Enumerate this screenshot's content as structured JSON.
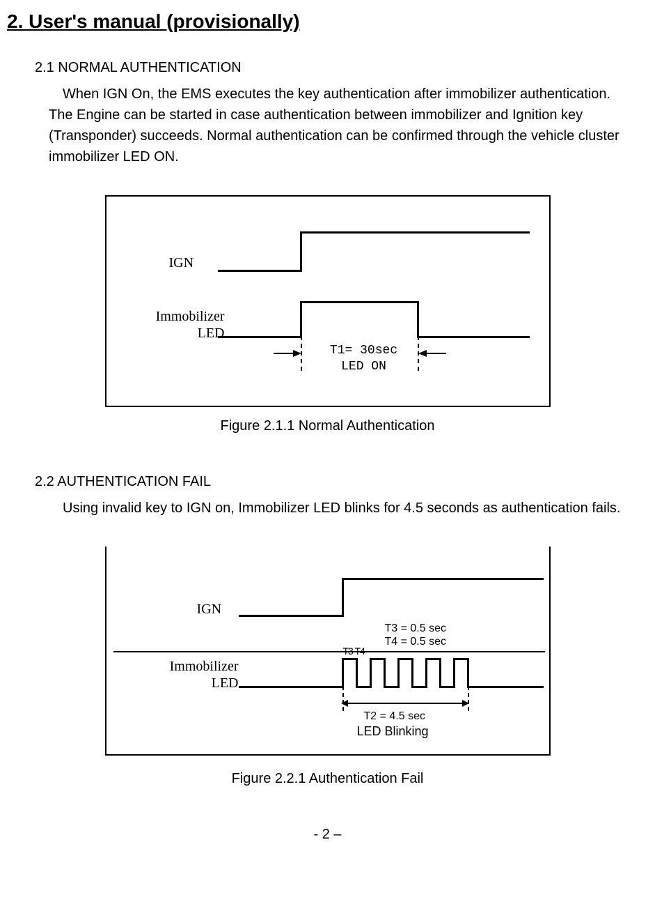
{
  "heading": "2. User's manual (provisionally)",
  "section21": {
    "title": "2.1 NORMAL AUTHENTICATION",
    "para": "When IGN On, the EMS executes the key authentication after immobilizer authentication. The Engine can be started in case authentication between immobilizer and Ignition key (Transponder) succeeds. Normal authentication can be confirmed through the vehicle cluster immobilizer LED ON."
  },
  "fig1": {
    "ign": "IGN",
    "immobilizer": "Immobilizer",
    "led": "LED",
    "t1_line1": "T1= 30sec",
    "t1_line2": "LED ON",
    "caption": "Figure 2.1.1 Normal Authentication"
  },
  "section22": {
    "title": "2.2 AUTHENTICATION FAIL",
    "para": "Using invalid key to IGN on, Immobilizer LED blinks for 4.5 seconds as authentication fails."
  },
  "fig2": {
    "ign": "IGN",
    "immobilizer": "Immobilizer",
    "led": "LED",
    "t3": "T3 = 0.5 sec",
    "t4": "T4 = 0.5 sec",
    "t3t4": "T3 T4",
    "t2": "T2 = 4.5 sec",
    "blinking": "LED Blinking",
    "caption": "Figure 2.2.1 Authentication Fail"
  },
  "pagenum": "- 2 –",
  "chart_data": [
    {
      "type": "timing-diagram",
      "title": "Normal Authentication",
      "signals": [
        {
          "name": "IGN",
          "transitions": [
            {
              "t": "t_ign_on",
              "to": "high"
            }
          ]
        },
        {
          "name": "Immobilizer LED",
          "transitions": [
            {
              "t": "t_ign_on",
              "to": "high"
            },
            {
              "t": "t_ign_on + T1",
              "to": "low"
            }
          ]
        }
      ],
      "parameters": {
        "T1": "30 sec",
        "note": "LED ON"
      }
    },
    {
      "type": "timing-diagram",
      "title": "Authentication Fail",
      "signals": [
        {
          "name": "IGN",
          "transitions": [
            {
              "t": "t_ign_on",
              "to": "high"
            }
          ]
        },
        {
          "name": "Immobilizer LED",
          "pattern": "blink",
          "on": "T3",
          "off": "T4",
          "duration": "T2"
        }
      ],
      "parameters": {
        "T2": "4.5 sec",
        "T3": "0.5 sec",
        "T4": "0.5 sec",
        "note": "LED Blinking"
      }
    }
  ]
}
